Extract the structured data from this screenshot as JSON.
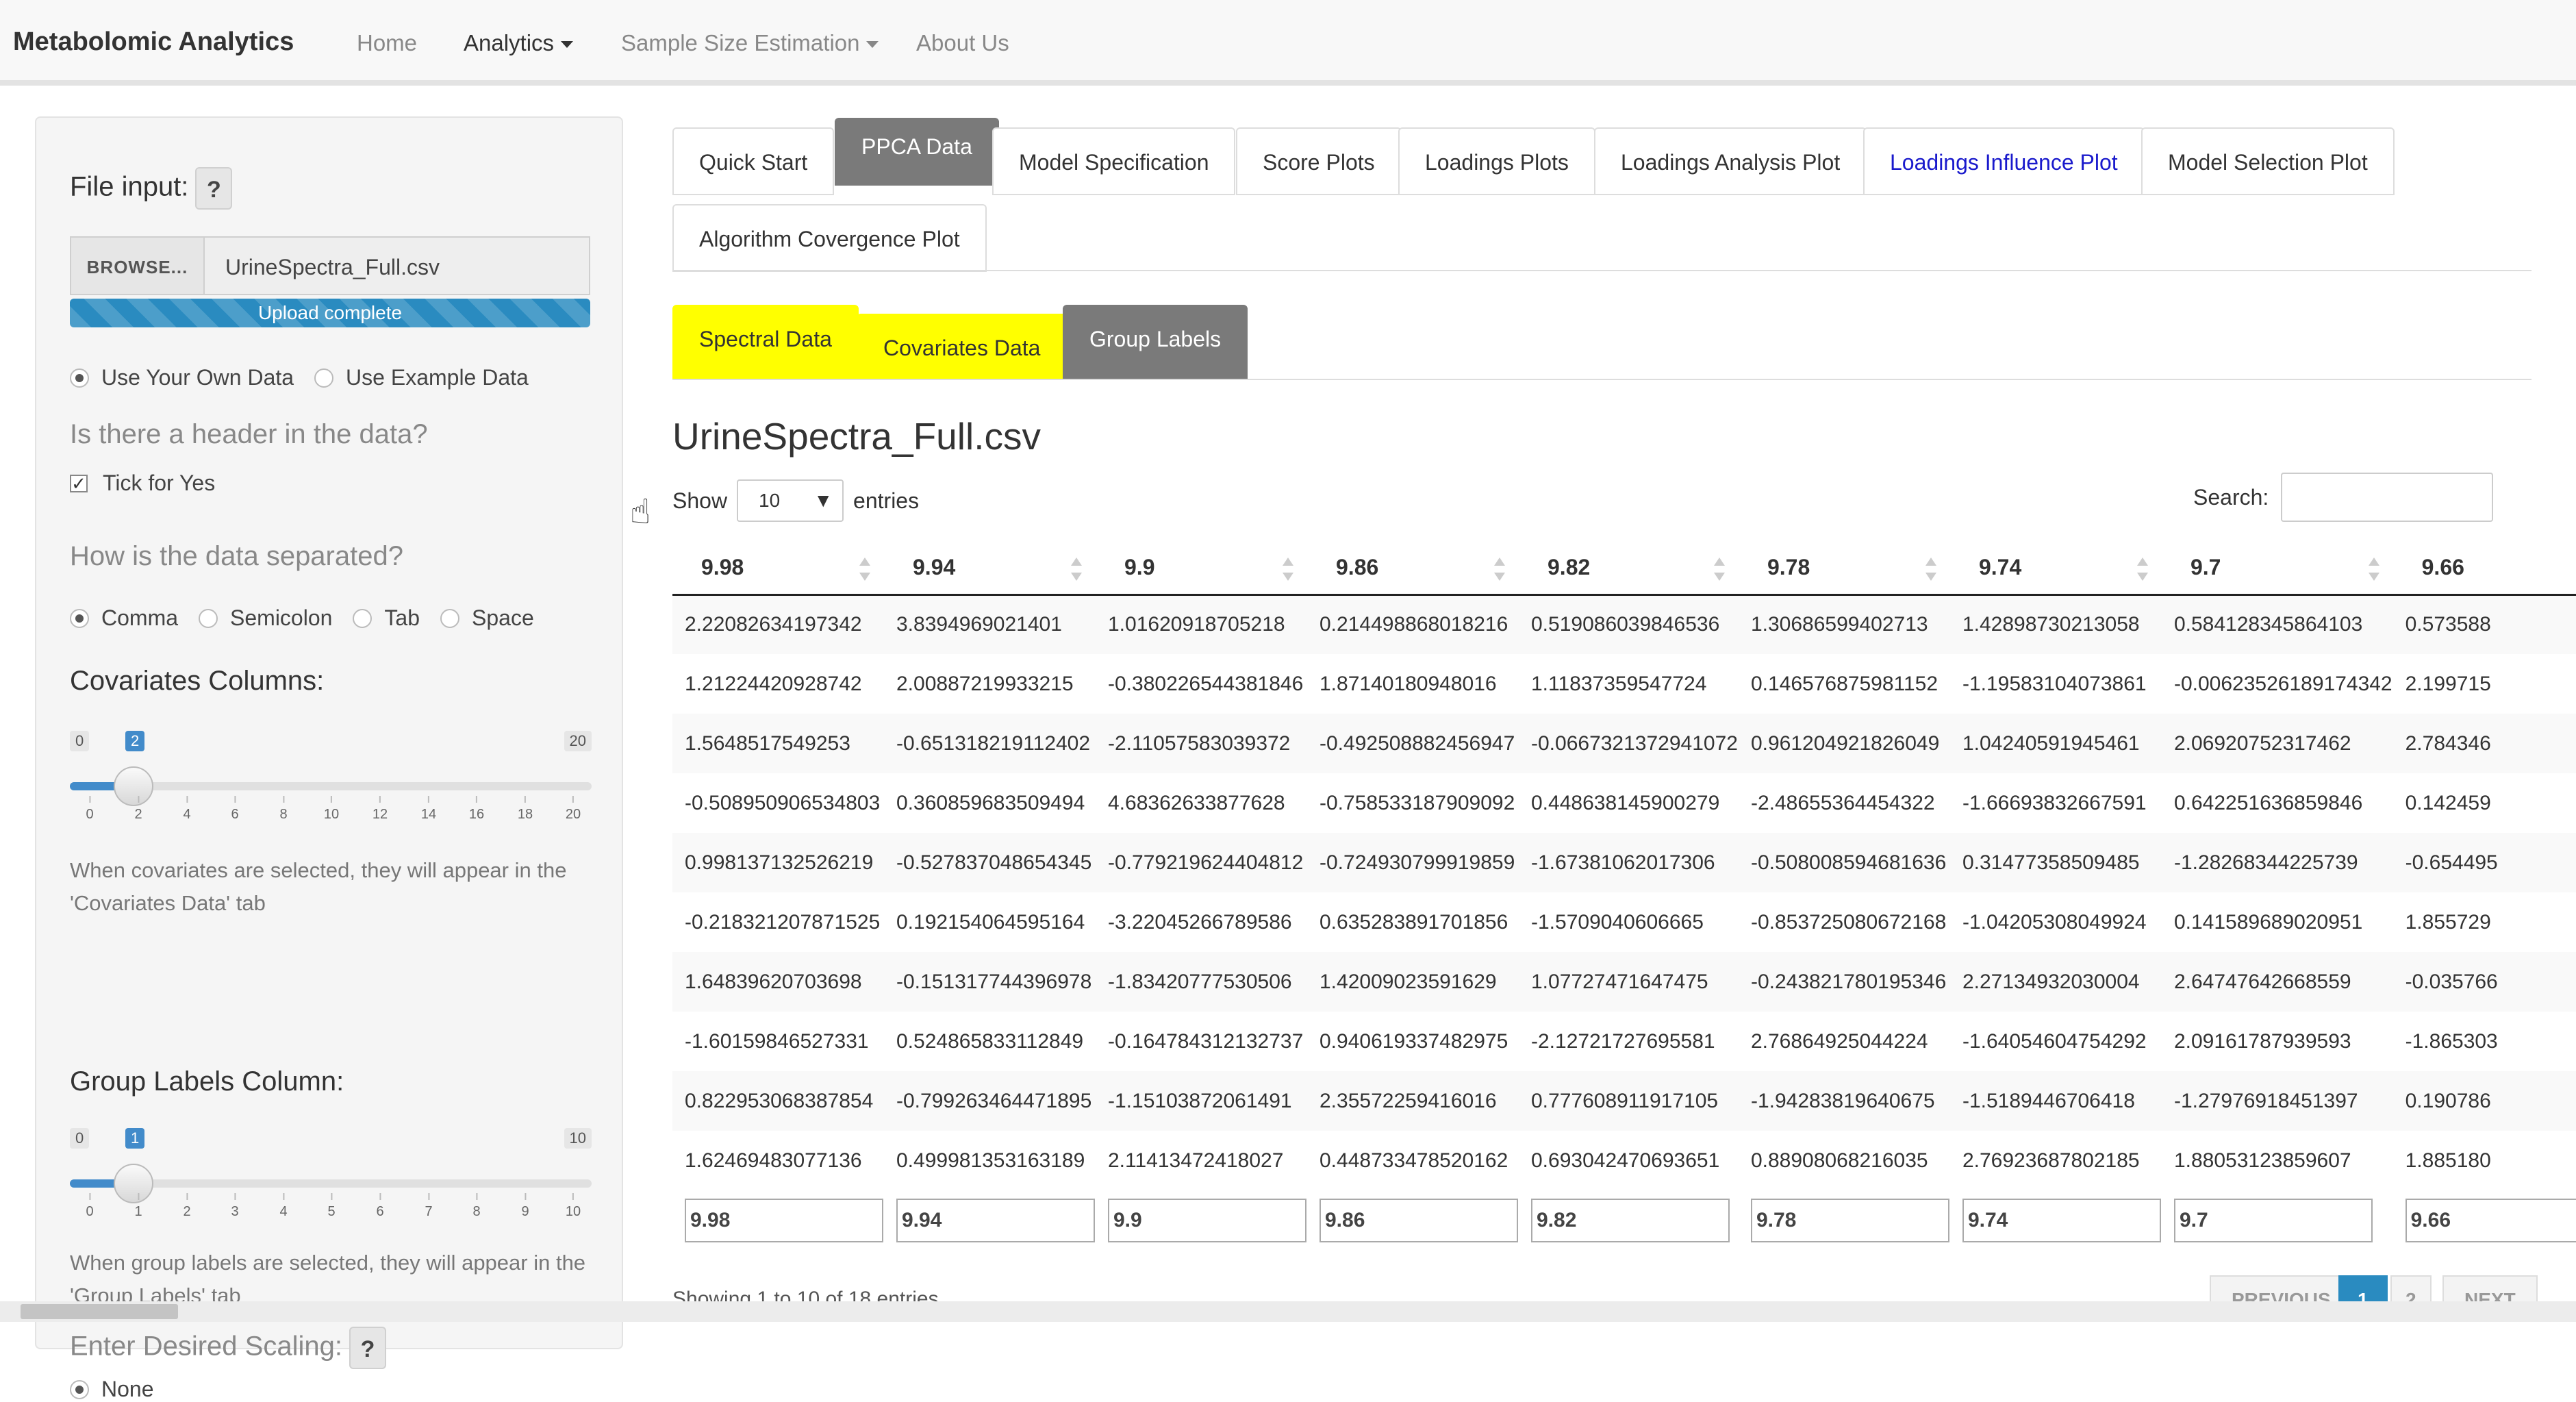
{
  "navbar": {
    "brand": "Metabolomic Analytics",
    "home": "Home",
    "analytics": "Analytics",
    "sample_size": "Sample Size Estimation",
    "about": "About Us"
  },
  "sidebar": {
    "file_input_label": "File input:",
    "help": "?",
    "browse": "BROWSE...",
    "filename": "UrineSpectra_Full.csv",
    "upload_status": "Upload complete",
    "data_source": [
      "Use Your Own Data",
      "Use Example Data"
    ],
    "header_question": "Is there a header in the data?",
    "tick_for_yes": "Tick for Yes",
    "sep_question": "How is the data separated?",
    "separators": [
      "Comma",
      "Semicolon",
      "Tab",
      "Space"
    ],
    "cov_label": "Covariates Columns:",
    "cov_slider": {
      "min": "0",
      "max": "20",
      "value": "2",
      "ticks": [
        "0",
        "2",
        "4",
        "6",
        "8",
        "10",
        "12",
        "14",
        "16",
        "18",
        "20"
      ]
    },
    "cov_note": "When covariates are selected, they will appear in the 'Covariates Data' tab",
    "group_label": "Group Labels Column:",
    "group_slider": {
      "min": "0",
      "max": "10",
      "value": "1",
      "ticks": [
        "0",
        "1",
        "2",
        "3",
        "4",
        "5",
        "6",
        "7",
        "8",
        "9",
        "10"
      ]
    },
    "group_note": "When group labels are selected, they will appear in the 'Group Labels' tab",
    "scaling_label": "Enter Desired Scaling:",
    "scaling_none": "None"
  },
  "tabs": {
    "main": [
      "Quick Start",
      "PPCA Data",
      "Model Specification",
      "Score Plots",
      "Loadings Plots",
      "Loadings Analysis Plot",
      "Loadings Influence Plot",
      "Model Selection Plot",
      "Algorithm Covergence Plot"
    ],
    "sub": [
      "Spectral Data",
      "Covariates Data",
      "Group Labels"
    ]
  },
  "content": {
    "title": "UrineSpectra_Full.csv",
    "show": "Show",
    "entries_value": "10",
    "entries": "entries",
    "search": "Search:",
    "info": "Showing 1 to 10 of 18 entries",
    "pager": [
      "PREVIOUS",
      "1",
      "2",
      "NEXT"
    ]
  },
  "table": {
    "headers": [
      "9.98",
      "9.94",
      "9.9",
      "9.86",
      "9.82",
      "9.78",
      "9.74",
      "9.7",
      "9.66"
    ],
    "rows": [
      [
        "2.22082634197342",
        "3.8394969021401",
        "1.01620918705218",
        "0.214498868018216",
        "0.519086039846536",
        "1.30686599402713",
        "1.42898730213058",
        "0.584128345864103",
        "0.573588"
      ],
      [
        "1.21224420928742",
        "2.00887219933215",
        "-0.380226544381846",
        "1.87140180948016",
        "1.11837359547724",
        "0.146576875981152",
        "-1.19583104073861",
        "-0.00623526189174342",
        "2.199715"
      ],
      [
        "1.5648517549253",
        "-0.651318219112402",
        "-2.11057583039372",
        "-0.492508882456947",
        "-0.0667321372941072",
        "0.961204921826049",
        "1.04240591945461",
        "2.06920752317462",
        "2.784346"
      ],
      [
        "-0.508950906534803",
        "0.360859683509494",
        "4.68362633877628",
        "-0.758533187909092",
        "0.448638145900279",
        "-2.48655364454322",
        "-1.66693832667591",
        "0.642251636859846",
        "0.142459"
      ],
      [
        "0.998137132526219",
        "-0.527837048654345",
        "-0.779219624404812",
        "-0.724930799919859",
        "-1.67381062017306",
        "-0.508008594681636",
        "0.31477358509485",
        "-1.28268344225739",
        "-0.654495"
      ],
      [
        "-0.218321207871525",
        "0.192154064595164",
        "-3.22045266789586",
        "0.635283891701856",
        "-1.5709040606665",
        "-0.853725080672168",
        "-1.04205308049924",
        "0.141589689020951",
        "1.855729"
      ],
      [
        "1.64839620703698",
        "-0.151317744396978",
        "-1.83420777530506",
        "1.42009023591629",
        "1.07727471647475",
        "-0.243821780195346",
        "2.27134932030004",
        "2.64747642668559",
        "-0.035766"
      ],
      [
        "-1.60159846527331",
        "0.524865833112849",
        "-0.164784312132737",
        "0.940619337482975",
        "-2.12721727695581",
        "2.76864925044224",
        "-1.64054604754292",
        "2.09161787939593",
        "-1.865303"
      ],
      [
        "0.822953068387854",
        "-0.799263464471895",
        "-1.15103872061491",
        "2.35572259416016",
        "0.777608911917105",
        "-1.94283819640675",
        "-1.5189446706418",
        "-1.27976918451397",
        "0.190786"
      ],
      [
        "1.62469483077136",
        "0.499981353163189",
        "2.11413472418027",
        "0.448733478520162",
        "0.693042470693651",
        "0.88908068216035",
        "2.76923687802185",
        "1.88053123859607",
        "1.885180"
      ]
    ]
  },
  "colors": {
    "accent": "#2a8bc0",
    "active_tab": "#7a7a7a",
    "highlight": "#ffff00",
    "link": "#1a1acc"
  }
}
